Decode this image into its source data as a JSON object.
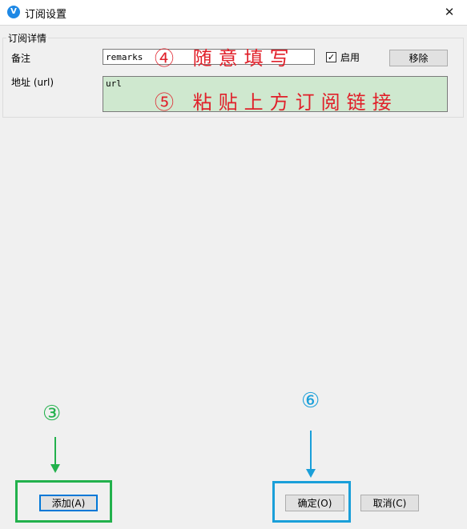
{
  "window": {
    "title": "订阅设置",
    "app_icon_glyph": "V",
    "close_glyph": "✕"
  },
  "details": {
    "group_title": "订阅详情",
    "remarks_label": "备注",
    "remarks_value": "remarks",
    "enable_label": "启用",
    "enable_checked": true,
    "remove_button": "移除",
    "url_label": "地址 (url)",
    "url_value": "url"
  },
  "footer": {
    "add_button": "添加(A)",
    "ok_button": "确定(O)",
    "cancel_button": "取消(C)"
  },
  "annotations": {
    "step4": "④ 随意填写",
    "step5": "⑤ 粘贴上方订阅链接",
    "step3": "③",
    "step6": "⑥",
    "colors": {
      "red": "#e0202a",
      "green": "#22b14c",
      "blue": "#1a9fd9"
    }
  }
}
